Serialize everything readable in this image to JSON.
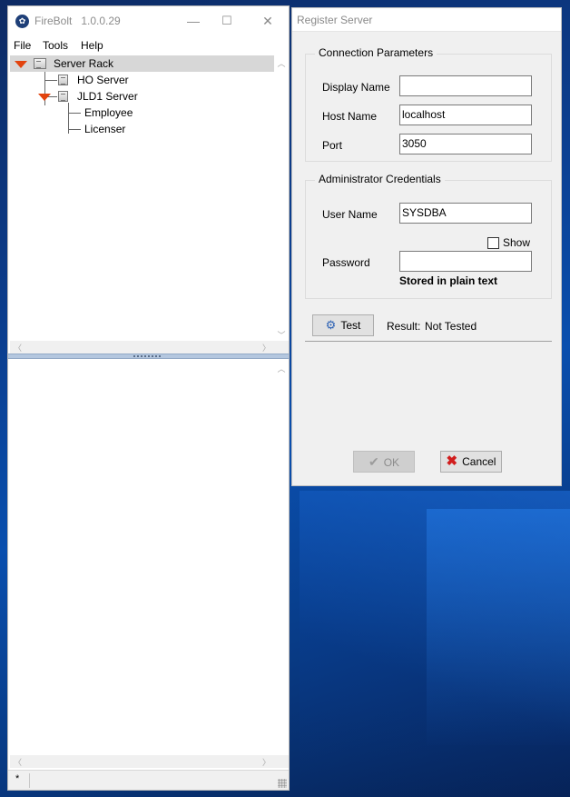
{
  "main_window": {
    "title": "FireBolt",
    "version": "1.0.0.29",
    "controls": {
      "minimize": "—",
      "maximize": "☐",
      "close": "✕"
    },
    "menu": [
      "File",
      "Tools",
      "Help"
    ],
    "tree": [
      {
        "label": "Server Rack",
        "level": 0,
        "expanded": true,
        "selected": true,
        "icon": "server-rack-icon"
      },
      {
        "label": "HO Server",
        "level": 1,
        "expanded": false,
        "selected": false,
        "icon": "server-icon"
      },
      {
        "label": "JLD1 Server",
        "level": 1,
        "expanded": true,
        "selected": false,
        "icon": "server-icon"
      },
      {
        "label": "Employee",
        "level": 2,
        "expanded": false,
        "selected": false,
        "icon": ""
      },
      {
        "label": "Licenser",
        "level": 2,
        "expanded": false,
        "selected": false,
        "icon": ""
      }
    ],
    "status": "*"
  },
  "dialog": {
    "title": "Register Server",
    "connection": {
      "legend": "Connection Parameters",
      "display_name": {
        "label": "Display Name",
        "value": ""
      },
      "host_name": {
        "label": "Host Name",
        "value": "localhost"
      },
      "port": {
        "label": "Port",
        "value": "3050"
      }
    },
    "credentials": {
      "legend": "Administrator Credentials",
      "user_name": {
        "label": "User Name",
        "value": "SYSDBA"
      },
      "show_label": "Show",
      "show_checked": false,
      "password": {
        "label": "Password",
        "value": ""
      },
      "note": "Stored in plain text"
    },
    "test": {
      "label": "Test",
      "result_label": "Result:",
      "result_value": "Not Tested"
    },
    "ok_label": "OK",
    "cancel_label": "Cancel"
  },
  "colors": {
    "expander": "#e2430e",
    "selection": "#d7d7d7",
    "cancel_icon": "#d11d1d",
    "test_icon": "#2d62b4",
    "desktop": "#0b3f91"
  }
}
